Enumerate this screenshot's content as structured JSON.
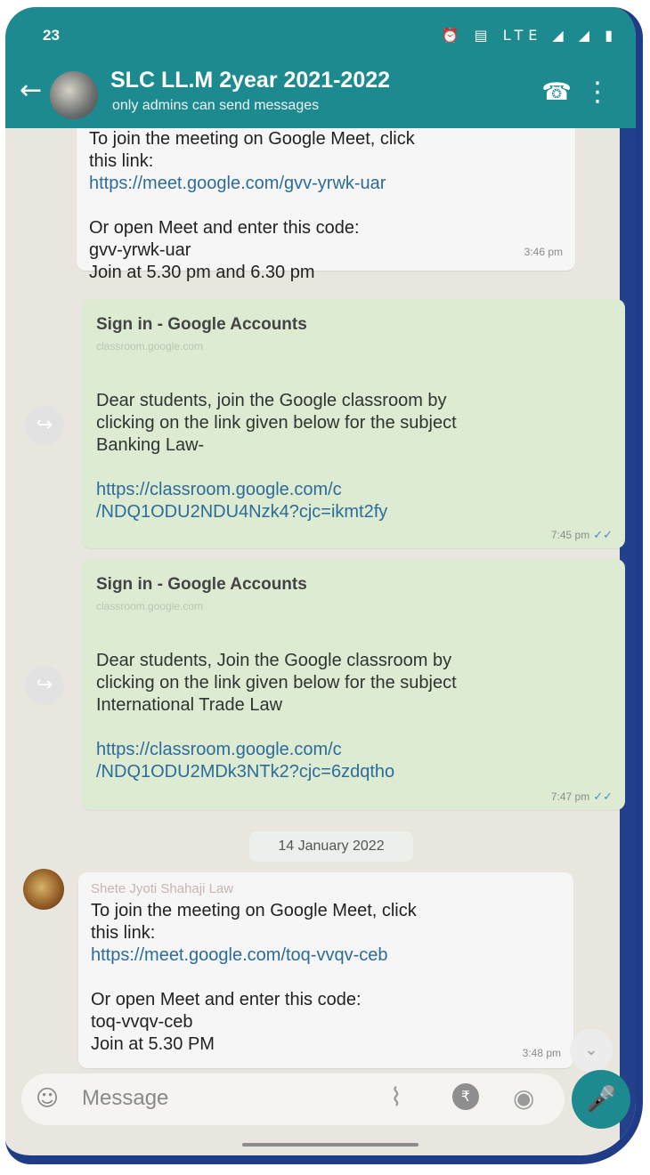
{
  "status": {
    "time": "23",
    "icons": "⏰ ▤ LTE ◢ ◢ ▮"
  },
  "header": {
    "title": "SLC LL.M 2year 2021-2022",
    "subtitle": "only admins can send messages"
  },
  "messages": [
    {
      "text": "To join the meeting on Google Meet, click\nthis link:",
      "link": "https://meet.google.com/gvv-yrwk-uar",
      "text2": "Or open Meet and enter this code:\ngvv-yrwk-uar\nJoin at 5.30 pm and 6.30 pm",
      "time": "3:46 pm"
    },
    {
      "preview_title": "Sign in - Google Accounts",
      "preview_sub": "classroom.google.com",
      "text": "Dear students, join the Google classroom by\nclicking on the link given below for the subject\nBanking Law-",
      "link": "https://classroom.google.com/c\n/NDQ1ODU2NDU4Nzk4?cjc=ikmt2fy",
      "time": "7:45 pm"
    },
    {
      "preview_title": "Sign in - Google Accounts",
      "preview_sub": "classroom.google.com",
      "text": "Dear students, Join the Google classroom by\nclicking on the link given below for the subject\nInternational Trade Law",
      "link": "https://classroom.google.com/c\n/NDQ1ODU2MDk3NTk2?cjc=6zdqtho",
      "time": "7:47 pm"
    },
    {
      "sender": "Shete Jyoti Shahaji Law",
      "text": "To join the meeting on Google Meet, click\nthis link:",
      "link": "https://meet.google.com/toq-vvqv-ceb",
      "text2": "Or open Meet and enter this code:\ntoq-vvqv-ceb\nJoin at 5.30 PM",
      "time": "3:48 pm"
    }
  ],
  "date_separator": "14 January 2022",
  "composer": {
    "placeholder": "Message"
  },
  "colors": {
    "header": "#1d8a8f",
    "outgoing_bubble": "#dcebd2",
    "incoming_bubble": "#f6f6f6",
    "background": "#e9e6e0"
  }
}
